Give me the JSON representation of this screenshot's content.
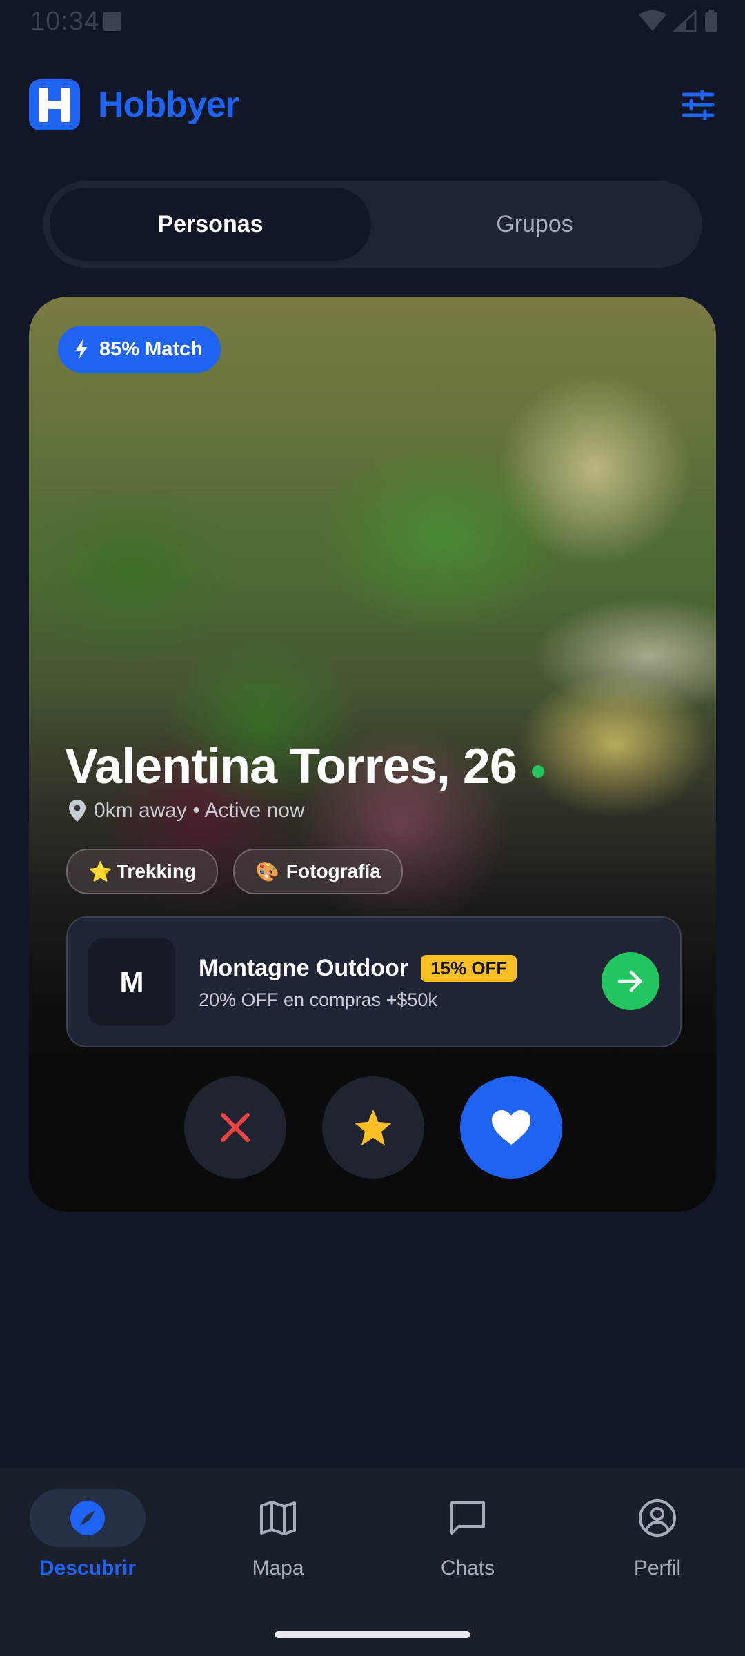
{
  "status_bar": {
    "time": "10:34"
  },
  "app": {
    "name": "Hobbyer",
    "logo_letter": "H",
    "brand_color": "#1f63f2"
  },
  "tabs": [
    {
      "label": "Personas",
      "active": true
    },
    {
      "label": "Grupos",
      "active": false
    }
  ],
  "card": {
    "match": "85% Match",
    "name": "Valentina Torres, 26",
    "meta": "0km away • Active now",
    "online": true,
    "tags": [
      {
        "emoji": "⭐",
        "label": "Trekking"
      },
      {
        "emoji": "🎨",
        "label": "Fotografía"
      }
    ],
    "promo": {
      "logo_letter": "M",
      "title": "Montagne Outdoor",
      "badge": "15% OFF",
      "subtitle": "20% OFF en compras +$50k"
    }
  },
  "actions": [
    {
      "icon": "close-icon",
      "color": "#ef4444"
    },
    {
      "icon": "star-icon",
      "color": "#fbbf24"
    },
    {
      "icon": "heart-icon",
      "color": "#ffffff"
    }
  ],
  "nav": [
    {
      "label": "Descubrir",
      "icon": "compass-icon",
      "active": true
    },
    {
      "label": "Mapa",
      "icon": "map-icon",
      "active": false
    },
    {
      "label": "Chats",
      "icon": "chat-icon",
      "active": false
    },
    {
      "label": "Perfil",
      "icon": "profile-icon",
      "active": false
    }
  ]
}
